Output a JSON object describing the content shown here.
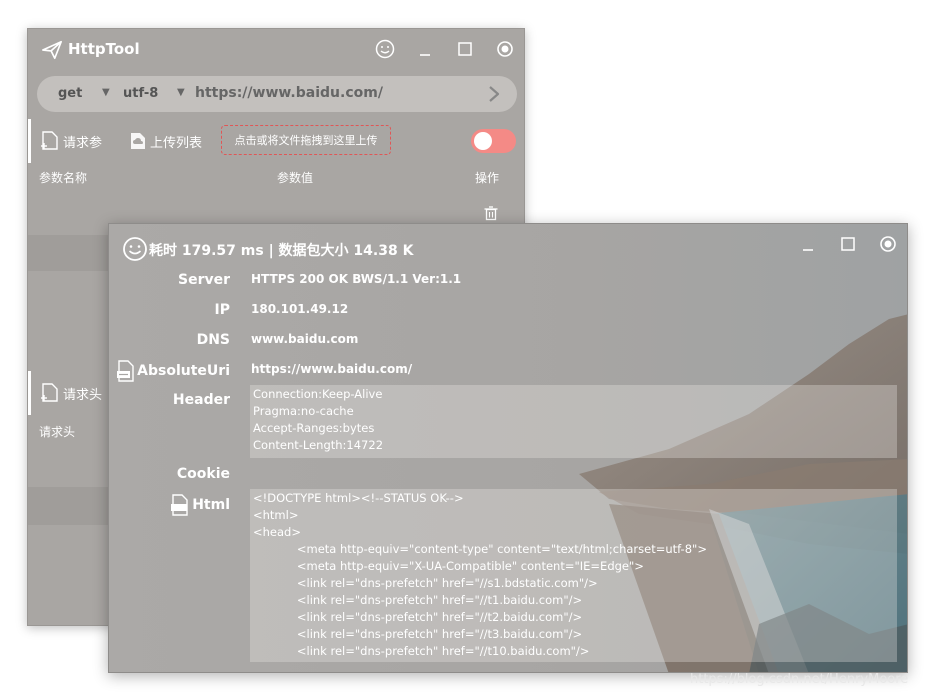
{
  "back_window": {
    "title": "HttpTool",
    "url_bar": {
      "method": "get",
      "encoding": "utf-8",
      "url": "https://www.baidu.com/"
    },
    "tabs": {
      "params": "请求参",
      "upload_list": "上传列表",
      "upload_hint": "点击或将文件拖拽到这里上传"
    },
    "table": {
      "col_name": "参数名称",
      "col_value": "参数值",
      "col_action": "操作"
    },
    "headers_tab": "请求头",
    "headers_sub_label": "请求头"
  },
  "front_window": {
    "title": "耗时 179.57 ms | 数据包大小 14.38 K",
    "fields": {
      "server_label": "Server",
      "server_value": "HTTPS 200 OK BWS/1.1 Ver:1.1",
      "ip_label": "IP",
      "ip_value": "180.101.49.12",
      "dns_label": "DNS",
      "dns_value": "www.baidu.com",
      "uri_label": "AbsoluteUri",
      "uri_value": "https://www.baidu.com/",
      "header_label": "Header",
      "cookie_label": "Cookie",
      "html_label": "Html"
    },
    "header_lines": [
      "Connection:Keep-Alive",
      "Pragma:no-cache",
      "Accept-Ranges:bytes",
      "Content-Length:14722"
    ],
    "html_lines": [
      "<!DOCTYPE html><!--STATUS OK-->",
      "<html>",
      "<head>",
      "            <meta http-equiv=\"content-type\" content=\"text/html;charset=utf-8\">",
      "            <meta http-equiv=\"X-UA-Compatible\" content=\"IE=Edge\">",
      "            <link rel=\"dns-prefetch\" href=\"//s1.bdstatic.com\"/>",
      "            <link rel=\"dns-prefetch\" href=\"//t1.baidu.com\"/>",
      "            <link rel=\"dns-prefetch\" href=\"//t2.baidu.com\"/>",
      "            <link rel=\"dns-prefetch\" href=\"//t3.baidu.com\"/>",
      "            <link rel=\"dns-prefetch\" href=\"//t10.baidu.com\"/>"
    ]
  },
  "watermark": "https://blog.csdn.net/HenryMoore",
  "colors": {
    "toggle_on": "#f48a86",
    "upload_border": "#e05656"
  }
}
